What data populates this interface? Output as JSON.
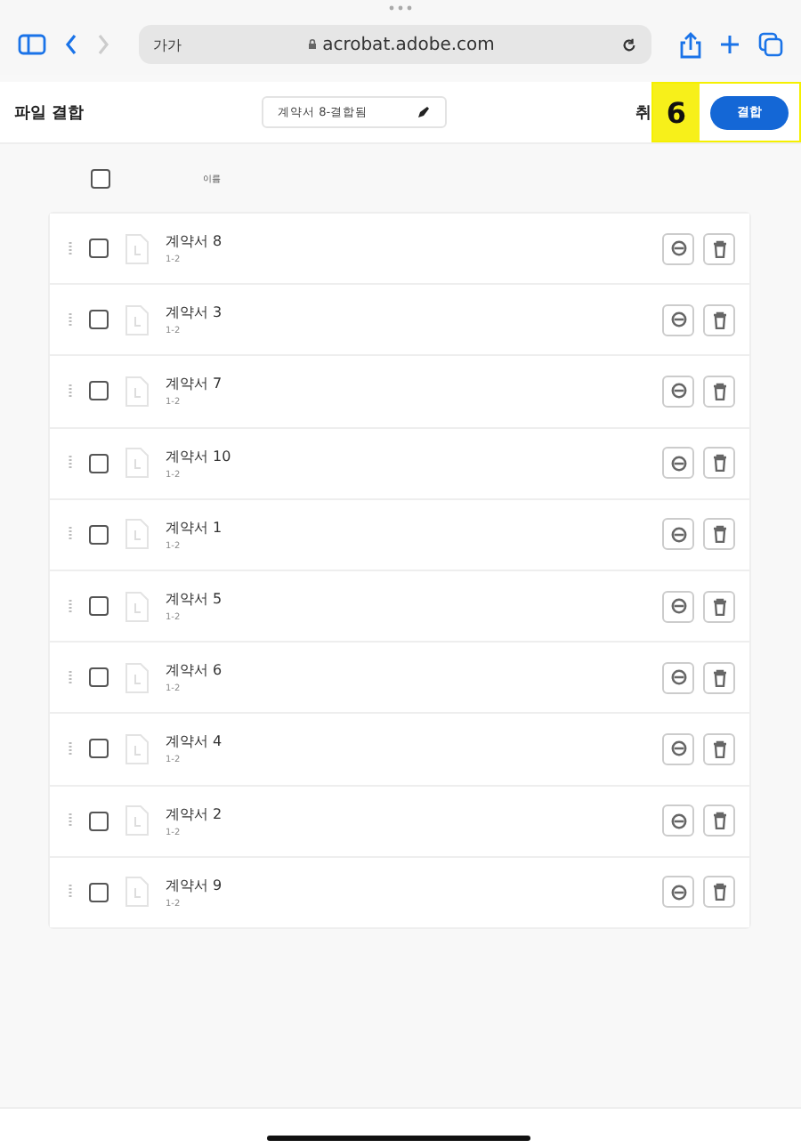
{
  "browser": {
    "text_size": "가가",
    "address": "acrobat.adobe.com"
  },
  "header": {
    "title": "파일 결합",
    "filename": "계약서 8-결합됨",
    "cancel": "취",
    "annotation": "6",
    "combine_button": "결합"
  },
  "list_header": {
    "select_all_checked": false,
    "name_column": "이름"
  },
  "files": [
    {
      "name": "계약서 8",
      "pages": "1-2",
      "checked": false
    },
    {
      "name": "계약서 3",
      "pages": "1-2",
      "checked": false
    },
    {
      "name": "계약서 7",
      "pages": "1-2",
      "checked": false
    },
    {
      "name": "계약서 10",
      "pages": "1-2",
      "checked": false
    },
    {
      "name": "계약서 1",
      "pages": "1-2",
      "checked": false
    },
    {
      "name": "계약서 5",
      "pages": "1-2",
      "checked": false
    },
    {
      "name": "계약서 6",
      "pages": "1-2",
      "checked": false
    },
    {
      "name": "계약서 4",
      "pages": "1-2",
      "checked": false
    },
    {
      "name": "계약서 2",
      "pages": "1-2",
      "checked": false
    },
    {
      "name": "계약서 9",
      "pages": "1-2",
      "checked": false
    }
  ]
}
